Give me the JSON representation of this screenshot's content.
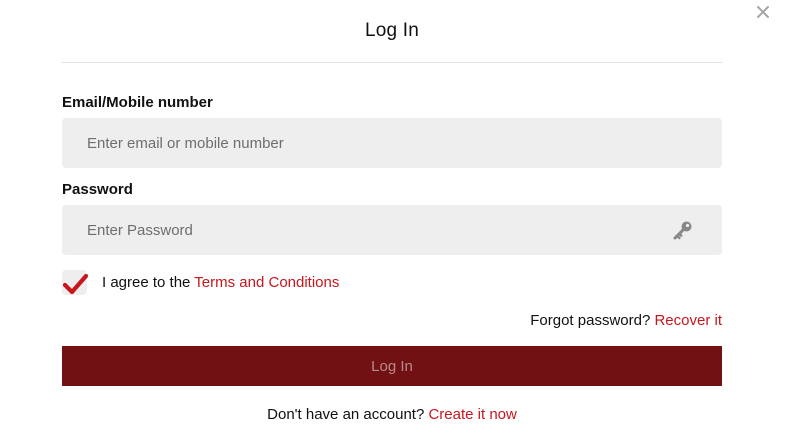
{
  "dialog": {
    "title": "Log In",
    "close_icon": "close-icon"
  },
  "email": {
    "label": "Email/Mobile number",
    "placeholder": "Enter email or mobile number",
    "value": ""
  },
  "password": {
    "label": "Password",
    "placeholder": "Enter Password",
    "value": "",
    "toggle_icon": "key-icon"
  },
  "agree": {
    "checked": true,
    "prefix": "I agree to the ",
    "link_text": "Terms and Conditions"
  },
  "forgot": {
    "prefix": "Forgot password? ",
    "link_text": "Recover it"
  },
  "submit": {
    "label": "Log In"
  },
  "signup": {
    "prefix": "Don't have an account? ",
    "link_text": "Create it now"
  },
  "colors": {
    "accent_link": "#c8161d",
    "button_bg": "#721114",
    "button_text": "#b98a8b",
    "field_bg": "#eeeeee",
    "check_mark": "#c8161d"
  }
}
